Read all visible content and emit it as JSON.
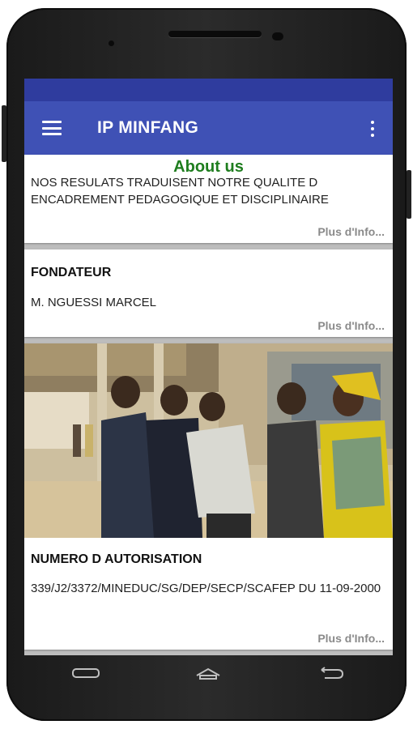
{
  "app": {
    "title": "IP MINFANG"
  },
  "page": {
    "heading": "About us"
  },
  "cards": [
    {
      "title": "",
      "text": "NOS RESULATS TRADUISENT NOTRE QUALITE D ENCADREMENT PEDAGOGIQUE ET DISCIPLINAIRE",
      "more": "Plus d'Info..."
    },
    {
      "title": "FONDATEUR",
      "text": "M. NGUESSI MARCEL",
      "more": "Plus d'Info..."
    },
    {
      "title": "NUMERO D AUTORISATION",
      "text": "339/J2/3372/MINEDUC/SG/DEP/SECP/SCAFEP DU 11-09-2000",
      "more": "Plus d'Info..."
    }
  ],
  "colors": {
    "appbar": "#3f51b5",
    "statusbar": "#2f3c9e",
    "heading": "#1e7d1e"
  },
  "icons": {
    "menu": "hamburger-menu-icon",
    "overflow": "more-vert-icon",
    "recents": "recent-apps-icon",
    "home": "home-icon",
    "back": "back-icon"
  }
}
